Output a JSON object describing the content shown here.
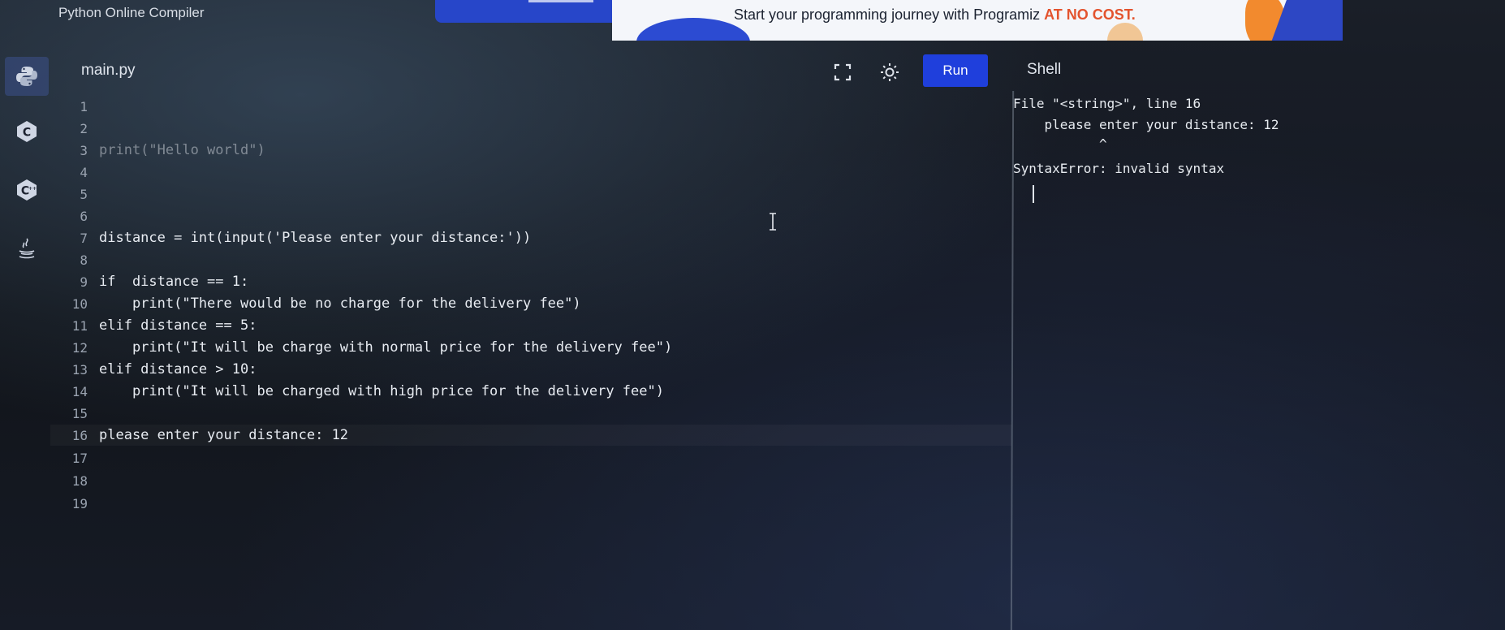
{
  "app": {
    "title": "Python Online Compiler"
  },
  "banner": {
    "text_main": "Start your programming journey with Programiz ",
    "text_accent": "AT NO COST."
  },
  "sidebar": {
    "items": [
      {
        "icon": "python-icon",
        "active": true
      },
      {
        "icon": "c-language-icon",
        "active": false
      },
      {
        "icon": "cpp-language-icon",
        "active": false
      },
      {
        "icon": "java-icon",
        "active": false
      }
    ]
  },
  "editor": {
    "filename": "main.py",
    "toolbar": {
      "run_label": "Run"
    },
    "lines": [
      {
        "no": "1",
        "code": ""
      },
      {
        "no": "2",
        "code": ""
      },
      {
        "no": "3",
        "code": "print(\"Hello world\")"
      },
      {
        "no": "4",
        "code": ""
      },
      {
        "no": "5",
        "code": ""
      },
      {
        "no": "6",
        "code": ""
      },
      {
        "no": "7",
        "code": "distance = int(input('Please enter your distance:'))"
      },
      {
        "no": "8",
        "code": ""
      },
      {
        "no": "9",
        "code": "if  distance == 1:"
      },
      {
        "no": "10",
        "code": "    print(\"There would be no charge for the delivery fee\")"
      },
      {
        "no": "11",
        "code": "elif distance == 5:"
      },
      {
        "no": "12",
        "code": "    print(\"It will be charge with normal price for the delivery fee\")"
      },
      {
        "no": "13",
        "code": "elif distance > 10:"
      },
      {
        "no": "14",
        "code": "    print(\"It will be charged with high price for the delivery fee\")"
      },
      {
        "no": "15",
        "code": ""
      },
      {
        "no": "16",
        "code": "please enter your distance: 12"
      },
      {
        "no": "17",
        "code": ""
      },
      {
        "no": "18",
        "code": ""
      },
      {
        "no": "19",
        "code": ""
      }
    ]
  },
  "shell": {
    "title": "Shell",
    "output": [
      "File \"<string>\", line 16",
      "    please enter your distance: 12",
      "           ^",
      "SyntaxError: invalid syntax"
    ]
  },
  "colors": {
    "run_button": "#1f3fdc",
    "accent": "#e3532e"
  }
}
